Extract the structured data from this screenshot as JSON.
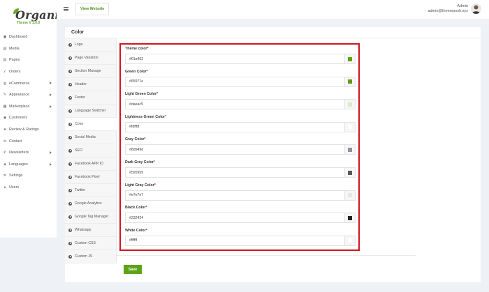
{
  "brand": {
    "name": "Organis",
    "version": "Theme V 1.0.0"
  },
  "sidebar": {
    "items": [
      {
        "label": "Dashboard",
        "icon": "dashboard-icon",
        "arrow": false
      },
      {
        "label": "Media",
        "icon": "media-icon",
        "arrow": false
      },
      {
        "label": "Pages",
        "icon": "pages-icon",
        "arrow": false
      },
      {
        "label": "Orders",
        "icon": "rocket-icon",
        "arrow": false
      },
      {
        "label": "eCommerce",
        "icon": "cart-icon",
        "arrow": true
      },
      {
        "label": "Appearance",
        "icon": "brush-icon",
        "arrow": true
      },
      {
        "label": "Marketplace",
        "icon": "marketplace-icon",
        "arrow": true
      },
      {
        "label": "Customers",
        "icon": "users-icon",
        "arrow": false
      },
      {
        "label": "Review & Ratings",
        "icon": "star-icon",
        "arrow": false
      },
      {
        "label": "Contact",
        "icon": "envelope-icon",
        "arrow": false
      },
      {
        "label": "Newsletters",
        "icon": "bell-icon",
        "arrow": true
      },
      {
        "label": "Languages",
        "icon": "language-icon",
        "arrow": true
      },
      {
        "label": "Settings",
        "icon": "gear-icon",
        "arrow": false
      },
      {
        "label": "Users",
        "icon": "user-icon",
        "arrow": false
      }
    ]
  },
  "topbar": {
    "view_website": "View Website",
    "admin_name": "Admin",
    "admin_email": "admin@themeposh.xyz"
  },
  "page": {
    "title": "Color"
  },
  "tabs": [
    {
      "label": "Logo",
      "active": false
    },
    {
      "label": "Page Variation",
      "active": false
    },
    {
      "label": "Section Manage",
      "active": false
    },
    {
      "label": "Header",
      "active": false
    },
    {
      "label": "Footer",
      "active": false
    },
    {
      "label": "Language Switcher",
      "active": false
    },
    {
      "label": "Color",
      "active": true
    },
    {
      "label": "Social Media",
      "active": false
    },
    {
      "label": "SEO",
      "active": false
    },
    {
      "label": "Facebook APP ID",
      "active": false
    },
    {
      "label": "Facebook Pixel",
      "active": false
    },
    {
      "label": "Twitter",
      "active": false
    },
    {
      "label": "Google Analytics",
      "active": false
    },
    {
      "label": "Google Tag Manager",
      "active": false
    },
    {
      "label": "Whatsapp",
      "active": false
    },
    {
      "label": "Custom CSS",
      "active": false
    },
    {
      "label": "Custom JS",
      "active": false
    }
  ],
  "fields": [
    {
      "label": "Theme color",
      "value": "#61a402"
    },
    {
      "label": "Green Color",
      "value": "#65971e"
    },
    {
      "label": "Light Green Color",
      "value": "#daeac5"
    },
    {
      "label": "Lightness Green Color",
      "value": "#fdfff8"
    },
    {
      "label": "Gray Color",
      "value": "#8d949d"
    },
    {
      "label": "Dark Gray Color",
      "value": "#595959"
    },
    {
      "label": "Light Gray Color",
      "value": "#e7e7e7"
    },
    {
      "label": "Black Color",
      "value": "#232424"
    },
    {
      "label": "White Color",
      "value": "#ffffff"
    }
  ],
  "required_mark": "*",
  "save_label": "Save",
  "colors": {
    "accent": "#5ca417",
    "highlight_border": "#d0141d"
  }
}
